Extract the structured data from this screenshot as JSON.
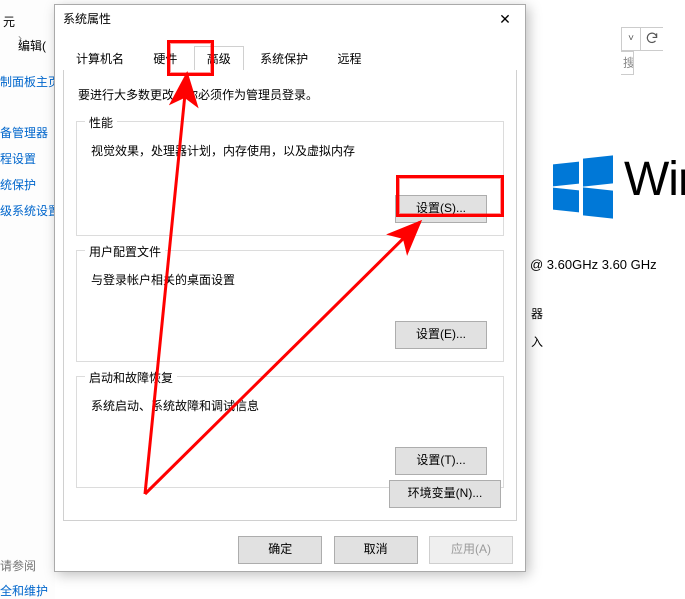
{
  "background": {
    "menu_edit_fragment": "编辑(",
    "nav_sep_arrow": "›",
    "nav_fragment_suffix": "元",
    "left_links": {
      "control_panel_home_fragment": "制面板主页",
      "device_manager_fragment": "备管理器",
      "remote_settings_fragment": "程设置",
      "system_protection_fragment": "统保护",
      "advanced_system_settings_fragment": "级系统设置"
    },
    "see_also": "请参阅",
    "security_and_maintain_fragment": "全和维护",
    "search_placeholder": "搜",
    "win_brand_fragment": "Wir",
    "cpu_fragment": "@ 3.60GHz   3.60 GHz",
    "right_partial_1": "器",
    "right_partial_2": "入"
  },
  "dialog": {
    "title": "系统属性",
    "tabs": {
      "computer_name": "计算机名",
      "hardware": "硬件",
      "advanced": "高级",
      "system_protection": "系统保护",
      "remote": "远程"
    },
    "active_tab": "advanced",
    "intro": "要进行大多数更改，你必须作为管理员登录。",
    "groups": {
      "performance": {
        "title": "性能",
        "desc": "视觉效果，处理器计划，内存使用，以及虚拟内存",
        "button": "设置(S)..."
      },
      "user_profiles": {
        "title": "用户配置文件",
        "desc": "与登录帐户相关的桌面设置",
        "button": "设置(E)..."
      },
      "startup_recovery": {
        "title": "启动和故障恢复",
        "desc": "系统启动、系统故障和调试信息",
        "button": "设置(T)..."
      }
    },
    "env_button": "环境变量(N)...",
    "buttons": {
      "ok": "确定",
      "cancel": "取消",
      "apply": "应用(A)"
    }
  }
}
